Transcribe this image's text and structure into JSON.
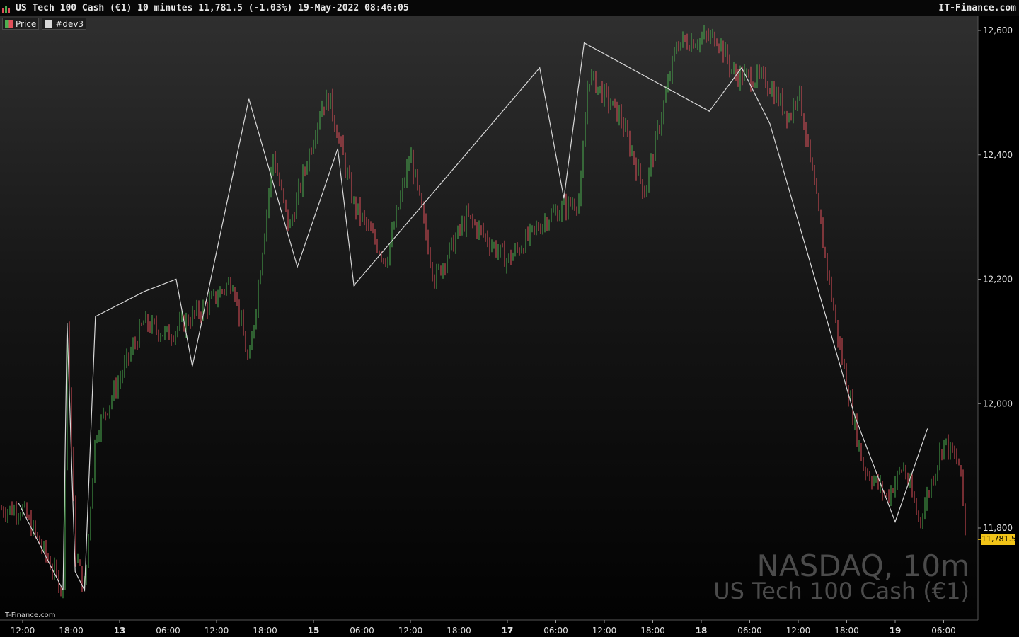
{
  "header": {
    "title": "US Tech 100 Cash (€1) 10 minutes 11,781.5 (-1.03%) 19-May-2022 08:46:05",
    "brand": "IT-Finance.com"
  },
  "legend": [
    {
      "label": "Price",
      "color": "#4caf50",
      "color2": "#e0505a"
    },
    {
      "label": "#dev3",
      "color": "#d8d8d8"
    }
  ],
  "watermark": {
    "line1": "NASDAQ, 10m",
    "line2": "US Tech 100 Cash (€1)"
  },
  "credit": "IT-Finance.com",
  "chart_data": {
    "type": "line",
    "series": [
      {
        "name": "Price",
        "kind": "ohlc-bars",
        "points": [
          [
            "12:00",
            11830
          ],
          [
            "17:00",
            11700
          ],
          [
            "17:30",
            12130
          ],
          [
            "18:30",
            11760
          ],
          [
            "19:40",
            11700
          ],
          [
            "21:00",
            11950
          ],
          [
            "13 03:00",
            12130
          ],
          [
            "13 06:00",
            12110
          ],
          [
            "13 11:00",
            12160
          ],
          [
            "13 14:00",
            12200
          ],
          [
            "13 16:00",
            12060
          ],
          [
            "13 19:00",
            12400
          ],
          [
            "13 21:00",
            12280
          ],
          [
            "15 01:00",
            12480
          ],
          [
            "15 02:00",
            12490
          ],
          [
            "15 05:00",
            12320
          ],
          [
            "15 09:00",
            12230
          ],
          [
            "15 12:00",
            12400
          ],
          [
            "15 15:00",
            12200
          ],
          [
            "15 19:00",
            12300
          ],
          [
            "16 00:00",
            12230
          ],
          [
            "16 05:00",
            12300
          ],
          [
            "16 09:00",
            12330
          ],
          [
            "16 10:00",
            12530
          ],
          [
            "16 14:00",
            12460
          ],
          [
            "16 17:00",
            12340
          ],
          [
            "16 21:00",
            12580
          ],
          [
            "17 02:00",
            12590
          ],
          [
            "17 04:00",
            12530
          ],
          [
            "17 08:00",
            12520
          ],
          [
            "17 11:00",
            12460
          ],
          [
            "17 12:00",
            12510
          ],
          [
            "17 17:00",
            12100
          ],
          [
            "17 20:00",
            11900
          ],
          [
            "17 23:00",
            11850
          ],
          [
            "18 01:00",
            11900
          ],
          [
            "18 03:00",
            11810
          ],
          [
            "18 06:00",
            11940
          ],
          [
            "18 08:00",
            11900
          ],
          [
            "18 08:46",
            11781.5
          ]
        ]
      },
      {
        "name": "#dev3",
        "kind": "zigzag",
        "points": [
          [
            "11:30",
            11840
          ],
          [
            "17:00",
            11700
          ],
          [
            "17:30",
            12130
          ],
          [
            "18:30",
            11730
          ],
          [
            "19:40",
            11700
          ],
          [
            "21:00",
            12140
          ],
          [
            "13 03:00",
            12180
          ],
          [
            "13 07:00",
            12200
          ],
          [
            "13 09:00",
            12060
          ],
          [
            "13 16:00",
            12490
          ],
          [
            "13 22:00",
            12220
          ],
          [
            "15 03:00",
            12410
          ],
          [
            "15 05:00",
            12190
          ],
          [
            "16 04:00",
            12540
          ],
          [
            "16 07:00",
            12330
          ],
          [
            "16 09:30",
            12580
          ],
          [
            "17 01:00",
            12470
          ],
          [
            "17 05:00",
            12540
          ],
          [
            "17 08:30",
            12450
          ],
          [
            "17 19:00",
            11980
          ],
          [
            "18 00:00",
            11810
          ],
          [
            "18 04:00",
            11960
          ]
        ]
      }
    ],
    "x_ticks": [
      "12:00",
      "18:00",
      "13",
      "06:00",
      "12:00",
      "18:00",
      "15",
      "06:00",
      "12:00",
      "18:00",
      "17",
      "06:00",
      "12:00",
      "18:00",
      "18",
      "06:00",
      "12:00",
      "18:00",
      "19",
      "06:00"
    ],
    "y_ticks": [
      "11,800",
      "12,000",
      "12,200",
      "12,400",
      "12,600"
    ],
    "ylim": [
      11690,
      12610
    ],
    "last_price": "11,781.5",
    "grid": false,
    "legend_position": "top-left"
  }
}
